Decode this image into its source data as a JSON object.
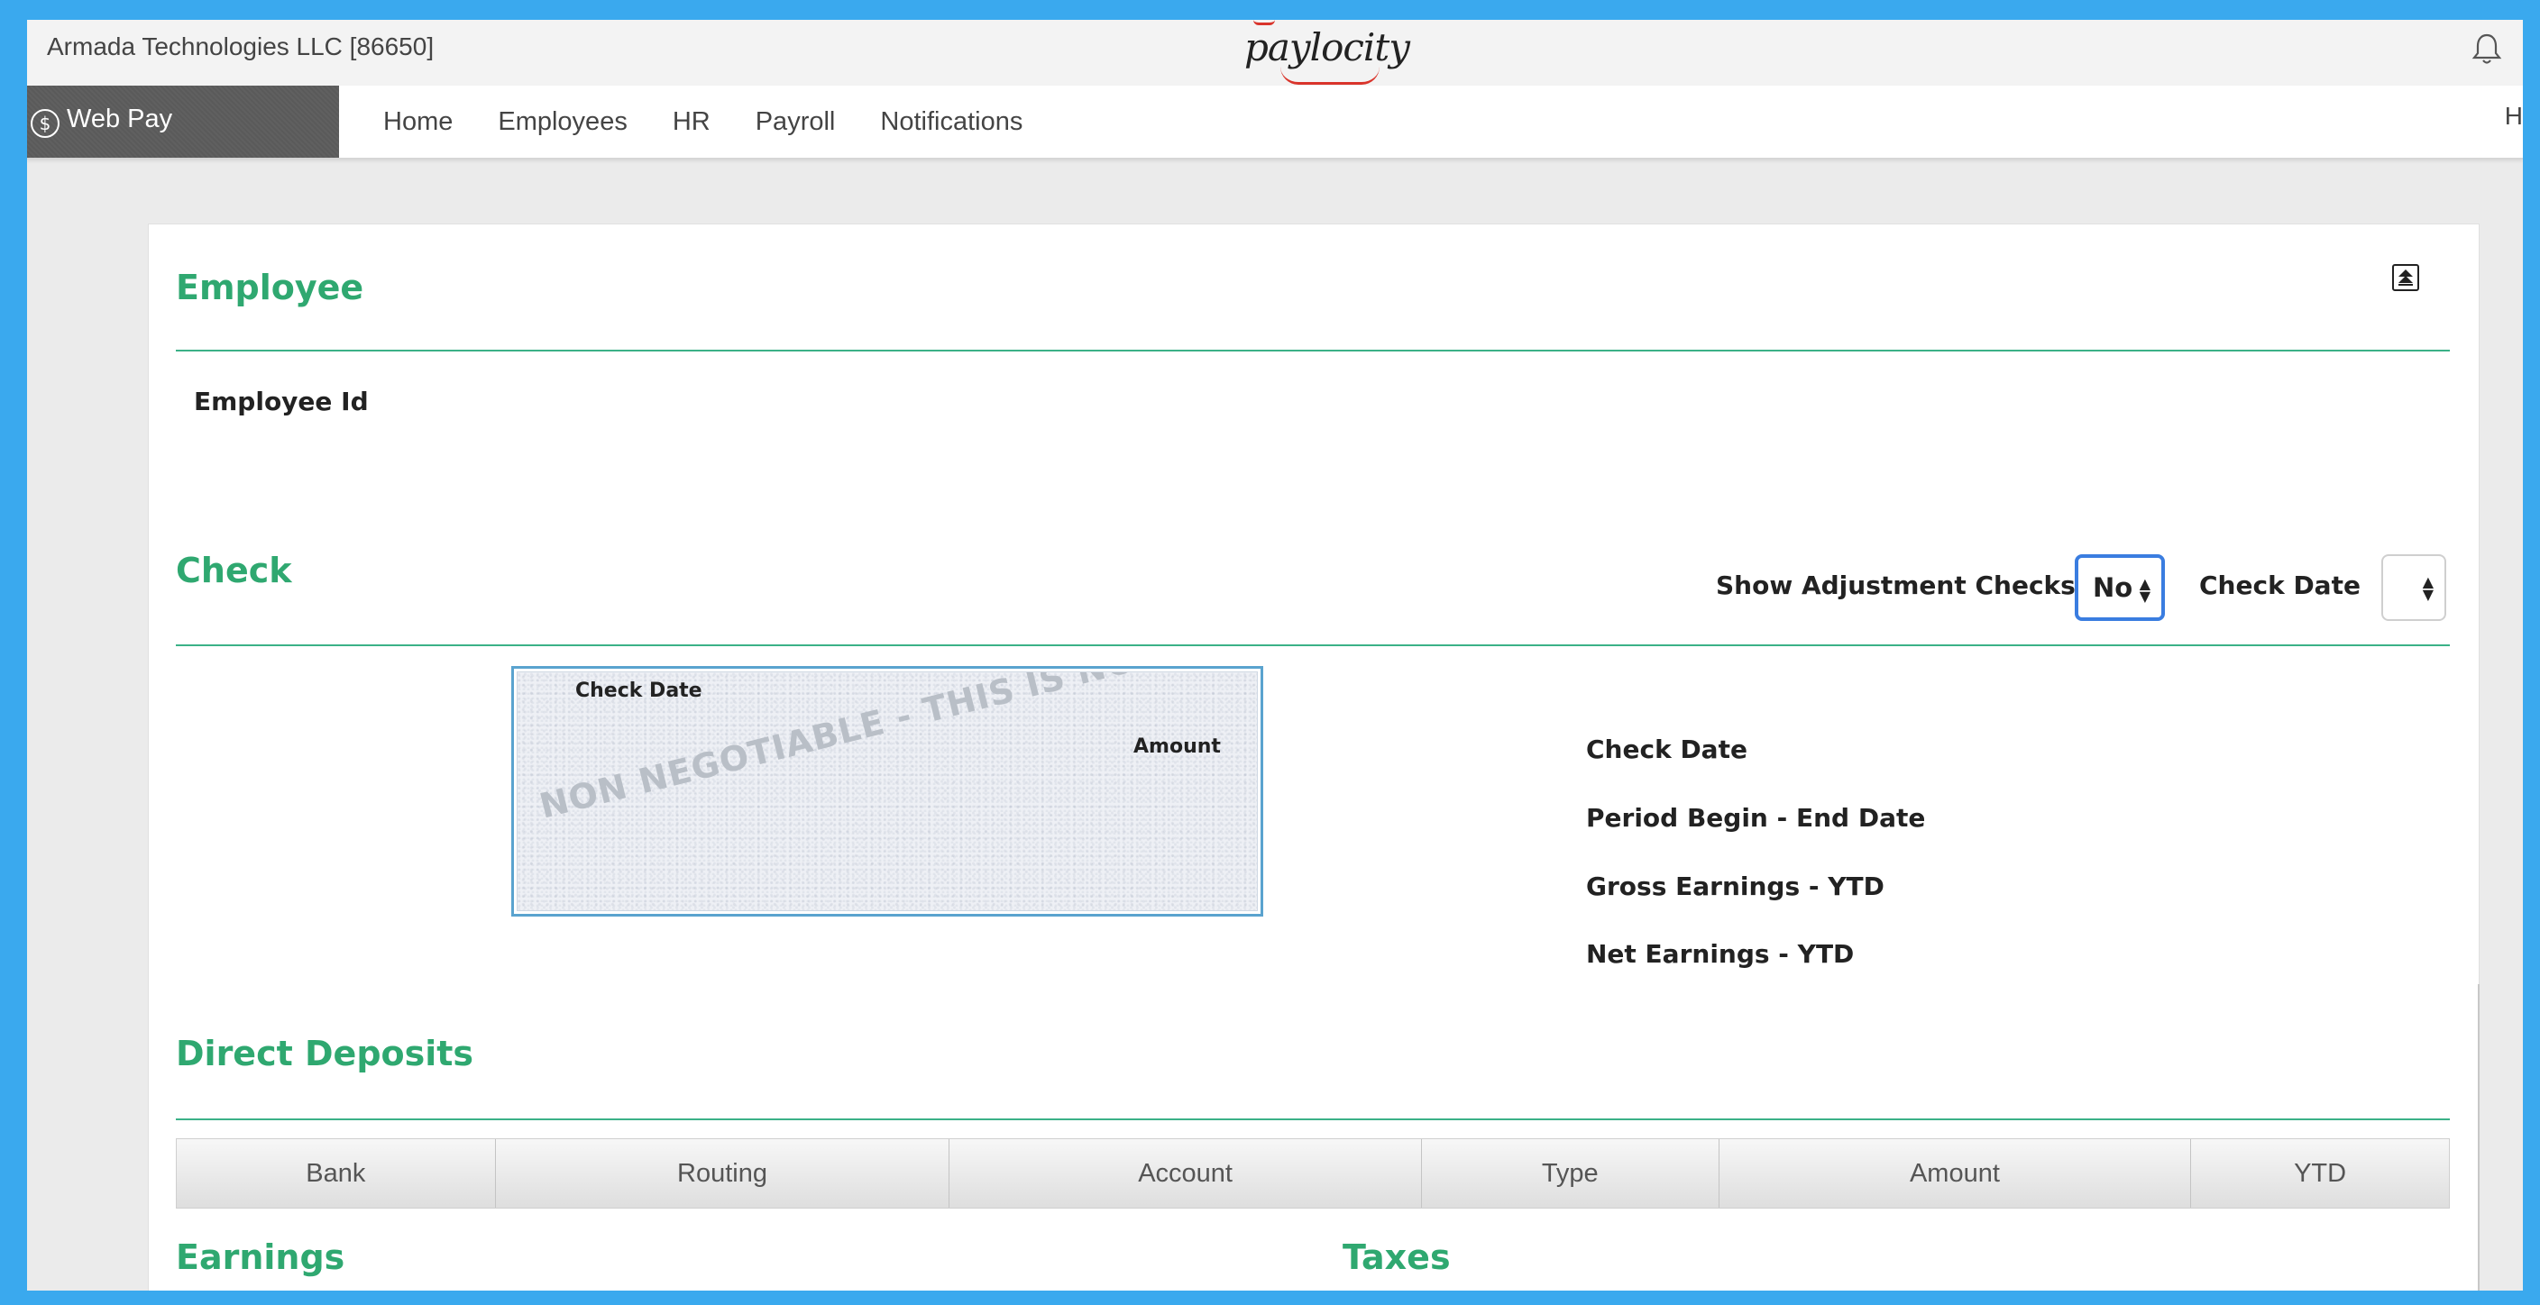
{
  "header": {
    "company": "Armada Technologies LLC [86650]",
    "logo_text": "paylocity",
    "bell_icon": "bell-icon"
  },
  "nav": {
    "brand_label": "Web Pay",
    "brand_icon": "dollar-circle-icon",
    "links": [
      "Home",
      "Employees",
      "HR",
      "Payroll",
      "Notifications"
    ],
    "edge_text": "H"
  },
  "employee": {
    "title": "Employee",
    "id_label": "Employee Id",
    "collapse_icon": "collapse-all-icon"
  },
  "check": {
    "title": "Check",
    "show_adjustment_label": "Show Adjustment Checks",
    "show_adjustment_value": "No",
    "check_date_label": "Check Date",
    "check_date_value": "",
    "image": {
      "check_date_label": "Check Date",
      "amount_label": "Amount",
      "watermark": "NON NEGOTIABLE - THIS IS NOT A CHECK"
    },
    "details": {
      "check_date": "Check Date",
      "period": "Period Begin - End Date",
      "gross": "Gross Earnings - YTD",
      "net": "Net Earnings - YTD"
    }
  },
  "direct_deposits": {
    "title": "Direct Deposits",
    "columns": [
      "Bank",
      "Routing",
      "Account",
      "Type",
      "Amount",
      "YTD"
    ]
  },
  "earnings": {
    "title": "Earnings"
  },
  "taxes": {
    "title": "Taxes"
  },
  "colors": {
    "accent": "#2fa870",
    "focus": "#3a7de0",
    "frame": "#3aa9ee"
  }
}
